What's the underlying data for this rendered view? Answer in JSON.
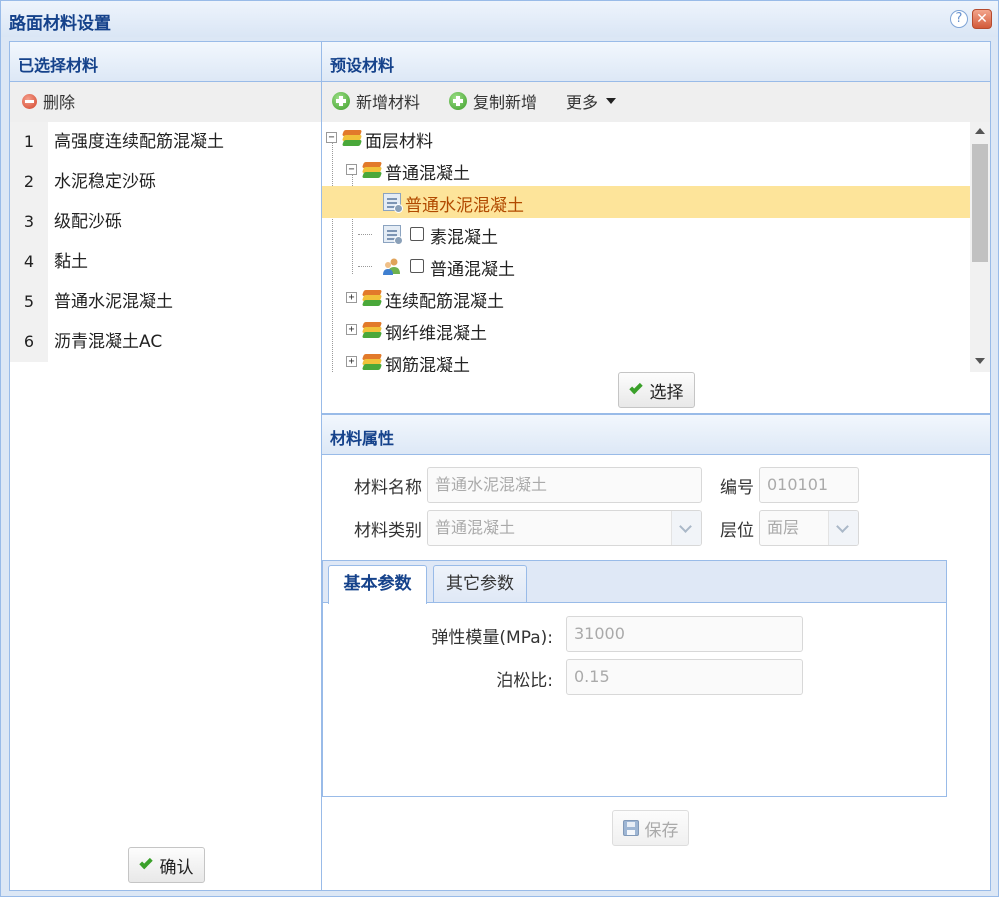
{
  "window": {
    "title": "路面材料设置"
  },
  "selected": {
    "header": "已选择材料",
    "delete_label": "删除",
    "rows": [
      {
        "num": "1",
        "name": "高强度连续配筋混凝土"
      },
      {
        "num": "2",
        "name": "水泥稳定沙砾"
      },
      {
        "num": "3",
        "name": "级配沙砾"
      },
      {
        "num": "4",
        "name": "黏土"
      },
      {
        "num": "5",
        "name": "普通水泥混凝土"
      },
      {
        "num": "6",
        "name": "沥青混凝土AC"
      }
    ],
    "confirm_label": "确认"
  },
  "preset": {
    "header": "预设材料",
    "add_label": "新增材料",
    "copy_label": "复制新增",
    "more_label": "更多",
    "tree": {
      "root": "面层材料",
      "group1": "普通混凝土",
      "leaf_selected": "普通水泥混凝土",
      "leaf2": "素混凝土",
      "leaf3": "普通混凝土",
      "group2": "连续配筋混凝土",
      "group3": "钢纤维混凝土",
      "group4": "钢筋混凝土"
    },
    "select_label": "选择"
  },
  "props": {
    "header": "材料属性",
    "name_label": "材料名称",
    "name_value": "普通水泥混凝土",
    "code_label": "编号",
    "code_value": "010101",
    "category_label": "材料类别",
    "category_value": "普通混凝土",
    "layer_label": "层位",
    "layer_value": "面层",
    "tabs": {
      "basic": "基本参数",
      "other": "其它参数"
    },
    "modulus_label": "弹性模量(MPa):",
    "modulus_value": "31000",
    "poisson_label": "泊松比:",
    "poisson_value": "0.15",
    "save_label": "保存"
  },
  "colors": {
    "header_text": "#15428b",
    "border": "#99bbe8",
    "selected_row": "#fde49a"
  }
}
